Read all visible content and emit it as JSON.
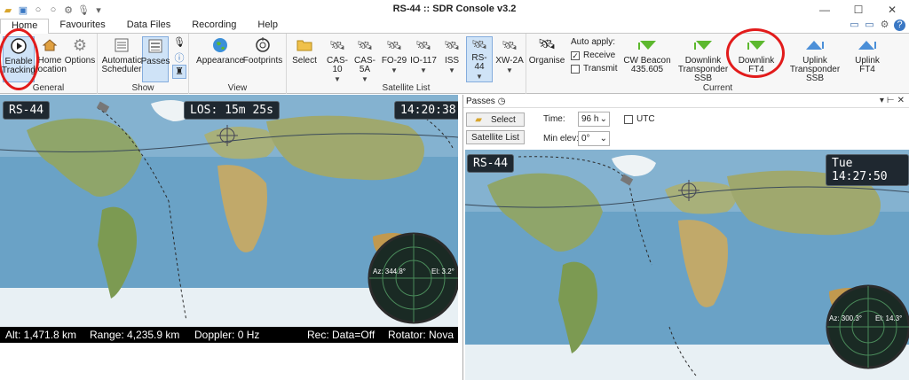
{
  "window": {
    "title": "RS-44 :: SDR Console v3.2",
    "controls": [
      "minimize-icon",
      "maximize-icon",
      "close-icon"
    ]
  },
  "quick_access": [
    "folder-icon",
    "window-icon",
    "circle-icon",
    "circle-icon",
    "gear-icon",
    "microphone-icon",
    "dropdown-icon"
  ],
  "tabs": [
    "Home",
    "Favourites",
    "Data Files",
    "Recording",
    "Help"
  ],
  "active_tab": "Home",
  "ribbon": {
    "general": {
      "caption": "General",
      "buttons": [
        {
          "label": "Enable\nTracking",
          "icon": "play-icon"
        },
        {
          "label": "Home\nLocation",
          "icon": "home-icon"
        },
        {
          "label": "Options",
          "icon": "gear-icon"
        }
      ]
    },
    "show": {
      "caption": "Show",
      "buttons": [
        {
          "label": "Automatic\nScheduler",
          "icon": "scheduler-icon"
        },
        {
          "label": "Passes",
          "icon": "list-icon"
        }
      ]
    },
    "view": {
      "caption": "View",
      "buttons": [
        {
          "label": "Appearance",
          "icon": "globe-icon"
        },
        {
          "label": "Footprints",
          "icon": "footprint-icon"
        }
      ]
    },
    "satellite_list": {
      "caption": "Satellite List",
      "select_label": "Select",
      "satellites": [
        "CAS-10",
        "CAS-5A",
        "FO-29",
        "IO-117",
        "ISS",
        "RS-44",
        "XW-2A"
      ]
    },
    "current": {
      "caption": "Current",
      "organise": "Organise",
      "auto_apply_title": "Auto apply:",
      "receive": "Receive",
      "transmit": "Transmit",
      "buttons": [
        {
          "label": "CW Beacon\n435.605",
          "icon": "down-arrow-icon"
        },
        {
          "label": "Downlink\nTransponder SSB",
          "icon": "down-arrow-icon"
        },
        {
          "label": "Downlink\nFT4",
          "icon": "down-arrow-icon"
        },
        {
          "label": "Uplink\nTransponder SSB",
          "icon": "up-arrow-icon"
        },
        {
          "label": "Uplink\nFT4",
          "icon": "up-arrow-icon"
        }
      ]
    }
  },
  "left_map": {
    "satellite": "RS-44",
    "los": "LOS: 15m 25s",
    "time": "14:20:38",
    "az": "Az: 344.8°",
    "el": "El: 3.2°"
  },
  "status": {
    "alt": "Alt: 1,471.8 km",
    "range": "Range: 4,235.9 km",
    "doppler": "Doppler: 0 Hz",
    "rec": "Rec: Data=Off",
    "rotator": "Rotator: Nova"
  },
  "passes": {
    "title": "Passes",
    "select_label": "Select",
    "satellite_list_label": "Satellite List",
    "time_label": "Time:",
    "time_value": "96 h",
    "utc_label": "UTC",
    "min_elev_label": "Min elev:",
    "min_elev_value": "0°",
    "map_satellite": "RS-44",
    "map_time": "Tue 14:27:50",
    "az": "Az: 300.3°",
    "el": "El: 14.3°"
  },
  "colors": {
    "accent": "#3a78c4",
    "highlight_ring": "#e21b1b",
    "ribbon_bg": "#f7f7f7",
    "download_green": "#5cb82e",
    "upload_blue": "#4b8fd8"
  }
}
